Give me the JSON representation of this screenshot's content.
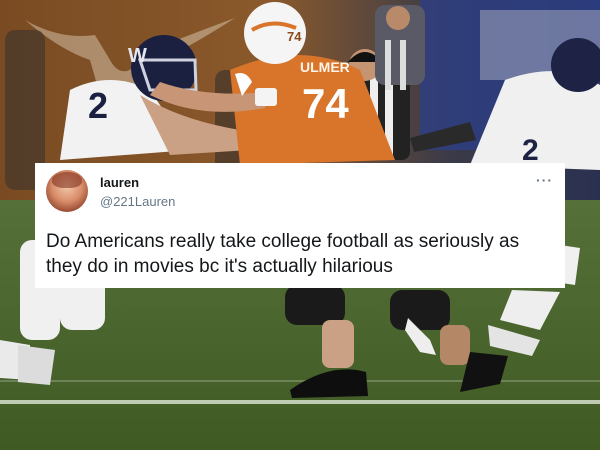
{
  "photo": {
    "jerseys": {
      "left_player_number": "2",
      "orange_player_number": "74",
      "orange_helmet_number": "74",
      "orange_nameplate": "ULMER",
      "right_player_number": "2"
    }
  },
  "tweet": {
    "display_name": "lauren",
    "handle": "@221Lauren",
    "more_icon": "ellipsis-icon",
    "text": "Do Americans really take college football as seriously as they do in movies bc it's actually hilarious"
  },
  "colors": {
    "orange_jersey": "#d9742b",
    "field_green": "#4f6b2c",
    "card_background": "#ffffff",
    "handle_gray": "#657786"
  }
}
